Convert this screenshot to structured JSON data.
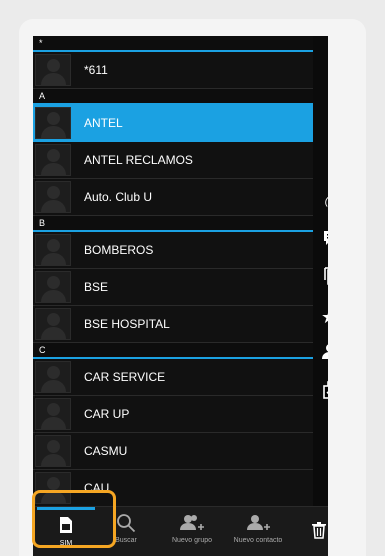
{
  "colors": {
    "accent": "#1ba1e2",
    "selected_row": "#1ba1e2",
    "highlight": "#f5a623"
  },
  "contacts": {
    "sections": [
      {
        "letter": "*",
        "items": [
          {
            "name": "*611"
          }
        ]
      },
      {
        "letter": "A",
        "items": [
          {
            "name": "ANTEL",
            "selected": true
          },
          {
            "name": "ANTEL RECLAMOS"
          },
          {
            "name": "Auto. Club U"
          }
        ]
      },
      {
        "letter": "B",
        "items": [
          {
            "name": "BOMBEROS"
          },
          {
            "name": "BSE"
          },
          {
            "name": "BSE HOSPITAL"
          }
        ]
      },
      {
        "letter": "C",
        "items": [
          {
            "name": "CAR SERVICE"
          },
          {
            "name": "CAR UP"
          },
          {
            "name": "CASMU"
          },
          {
            "name": "CAU"
          }
        ]
      }
    ]
  },
  "actions": [
    {
      "icon": "phone-icon"
    },
    {
      "icon": "message-icon"
    },
    {
      "icon": "copy-icon"
    },
    {
      "icon": "star-add-icon"
    },
    {
      "icon": "contact-edit-icon"
    },
    {
      "icon": "select-multiple-icon"
    }
  ],
  "tabs": [
    {
      "label": "SIM",
      "icon": "sim-icon",
      "active": true
    },
    {
      "label": "Buscar",
      "icon": "search-icon"
    },
    {
      "label": "Nuevo grupo",
      "icon": "new-group-icon"
    },
    {
      "label": "Nuevo contacto",
      "icon": "new-contact-icon"
    }
  ],
  "delete_icon": "delete-icon"
}
